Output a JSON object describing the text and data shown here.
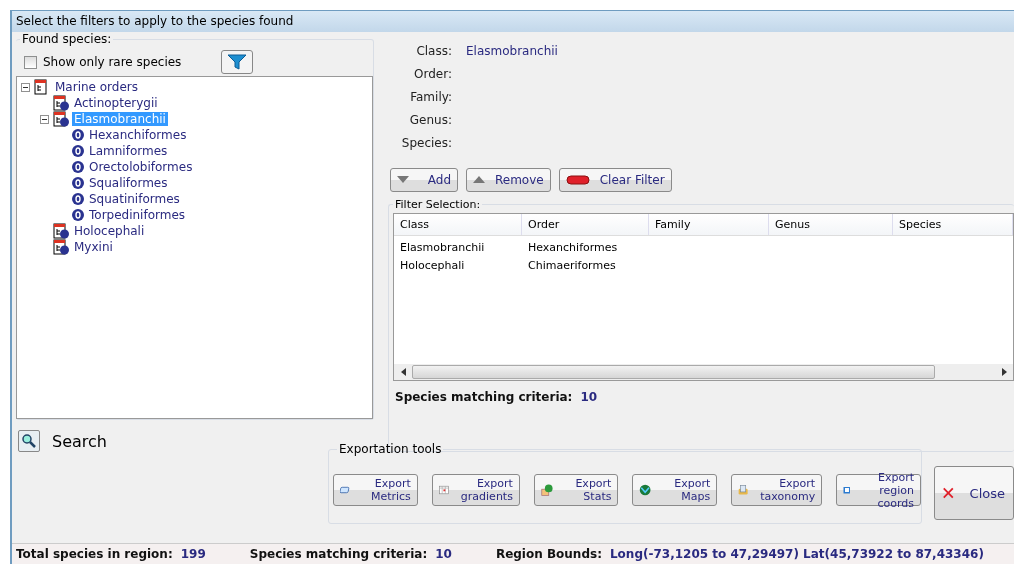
{
  "window": {
    "title": "Select the filters to apply to the species found"
  },
  "found_species": {
    "title": "Found species:",
    "rare_only": {
      "label": "Show only rare species",
      "checked": false
    },
    "tree": [
      {
        "label": "Marine orders",
        "kind": "root",
        "expanded": true,
        "selected": false,
        "children": [
          {
            "label": "Actinopterygii",
            "kind": "class",
            "selected": false
          },
          {
            "label": "Elasmobranchii",
            "kind": "class",
            "expanded": true,
            "selected": true,
            "children": [
              {
                "label": "Hexanchiformes",
                "kind": "order",
                "selected": false
              },
              {
                "label": "Lamniformes",
                "kind": "order",
                "selected": false
              },
              {
                "label": "Orectolobiformes",
                "kind": "order",
                "selected": false
              },
              {
                "label": "Squaliformes",
                "kind": "order",
                "selected": false
              },
              {
                "label": "Squatiniformes",
                "kind": "order",
                "selected": false
              },
              {
                "label": "Torpediniformes",
                "kind": "order",
                "selected": false
              }
            ]
          },
          {
            "label": "Holocephali",
            "kind": "class",
            "selected": false
          },
          {
            "label": "Myxini",
            "kind": "class",
            "selected": false
          }
        ]
      }
    ]
  },
  "fields": [
    {
      "label": "Class:",
      "value": "Elasmobranchii"
    },
    {
      "label": "Order:"
    },
    {
      "label": "Family:"
    },
    {
      "label": "Genus:"
    },
    {
      "label": "Species:"
    }
  ],
  "filter_buttons": [
    {
      "label": "Add",
      "kind": "add"
    },
    {
      "label": "Remove",
      "kind": "remove"
    },
    {
      "label": "Clear Filter",
      "kind": "clear"
    }
  ],
  "filter_selection": {
    "title": "Filter Selection:",
    "columns": [
      "Class",
      "Order",
      "Family",
      "Genus",
      "Species"
    ],
    "rows": [
      [
        "Elasmobranchii",
        "Hexanchiformes",
        "",
        "",
        ""
      ],
      [
        "Holocephali",
        "Chimaeriformes",
        "",
        "",
        ""
      ]
    ],
    "matching_label": "Species matching criteria:",
    "matching_value": "10"
  },
  "search": {
    "label": "Search"
  },
  "export_tools": {
    "title": "Exportation tools",
    "buttons": [
      {
        "label": "Export Metrics",
        "kind": "metrics"
      },
      {
        "label": "Export gradients",
        "kind": "gradients"
      },
      {
        "label": "Export Stats",
        "kind": "stats"
      },
      {
        "label": "Export Maps",
        "kind": "maps"
      },
      {
        "label": "Export taxonomy",
        "kind": "taxonomy"
      },
      {
        "label": "Export region coords",
        "kind": "coords"
      }
    ]
  },
  "close_button": {
    "label": "Close"
  },
  "status_bar": [
    {
      "label": "Total species in region:",
      "value": "199"
    },
    {
      "label": "Species matching criteria:",
      "value": "10"
    },
    {
      "label": "Region Bounds:",
      "value": "Long(-73,1205 to 47,29497) Lat(45,73922 to 87,43346)"
    }
  ]
}
